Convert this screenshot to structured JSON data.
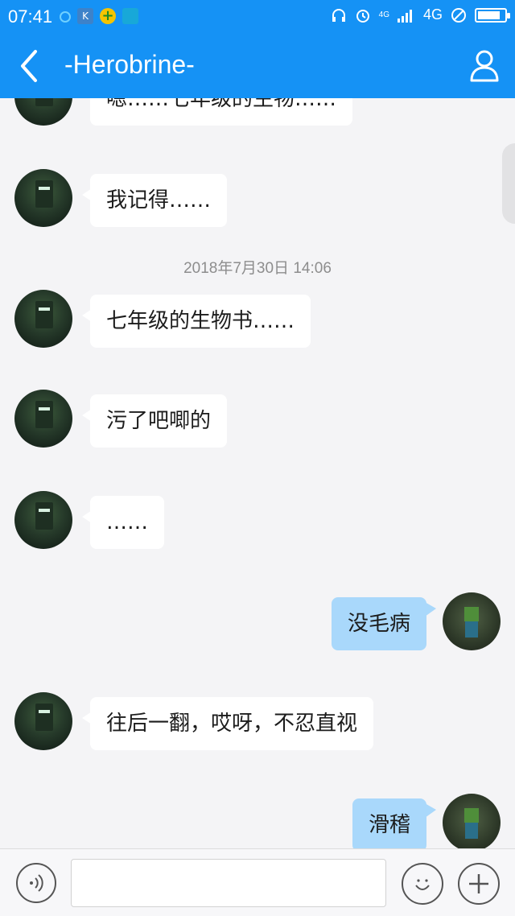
{
  "status_bar": {
    "time": "07:41",
    "network_label": "4G",
    "network_small_label": "4G",
    "battery_level": 0.85,
    "colors": {
      "background": "#1592f5"
    },
    "icons": [
      "notification-icon",
      "k-app-icon",
      "plus-app-icon",
      "scan-app-icon",
      "headphones-icon",
      "alarm-icon",
      "signal-icon",
      "no-disturb-icon",
      "battery-icon"
    ]
  },
  "nav": {
    "title": "-Herobrine-",
    "back_icon": "chevron-left-icon",
    "profile_icon": "person-icon"
  },
  "chat": {
    "timestamp": "2018年7月30日 14:06",
    "messages": [
      {
        "side": "in",
        "text": "嗯……七年级的生物……"
      },
      {
        "side": "in",
        "text": "我记得……"
      },
      {
        "side": "in",
        "text": "七年级的生物书……"
      },
      {
        "side": "in",
        "text": "污了吧唧的"
      },
      {
        "side": "in",
        "text": "……"
      },
      {
        "side": "out",
        "text": "没毛病"
      },
      {
        "side": "in",
        "text": "往后一翻，哎呀，不忍直视"
      },
      {
        "side": "out",
        "text": "滑稽"
      }
    ],
    "colors": {
      "incoming_bubble": "#ffffff",
      "outgoing_bubble": "#a9d8fb",
      "background": "#f4f4f6"
    }
  },
  "input_bar": {
    "value": "",
    "voice_icon": "voice-icon",
    "emoji_icon": "emoji-icon",
    "plus_icon": "plus-icon"
  }
}
